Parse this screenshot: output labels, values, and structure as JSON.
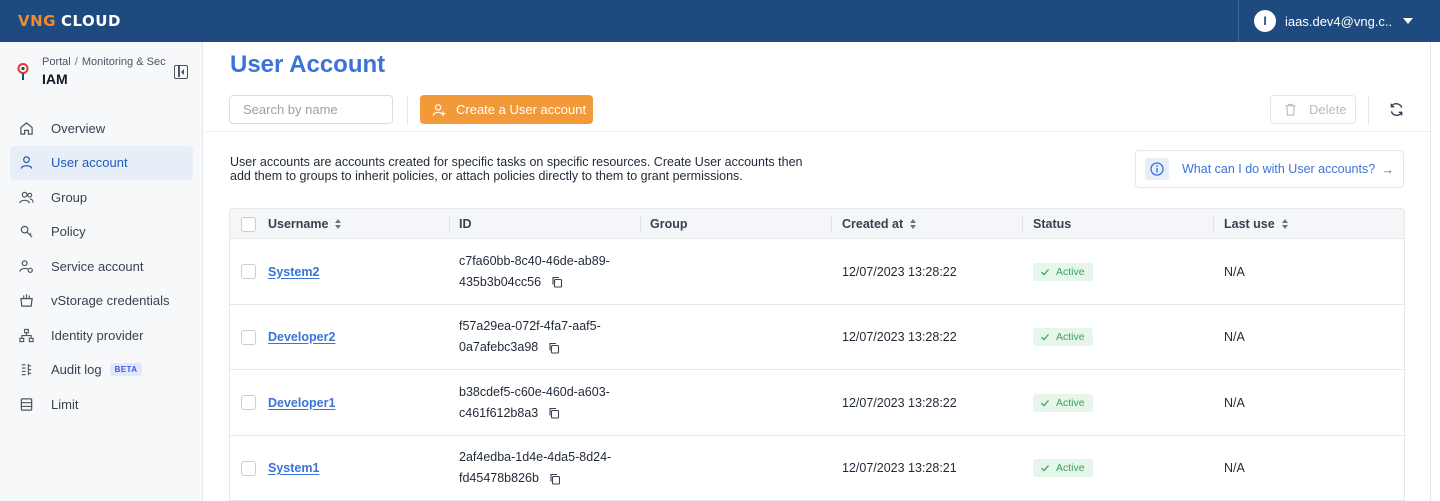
{
  "brand": {
    "logo_part1": "VNG",
    "logo_part2": "CLOUD",
    "color_dark": "#1e4a80",
    "color_accent": "#f08b2e"
  },
  "user": {
    "initial": "I",
    "email": "iaas.dev4@vng.c..."
  },
  "sidebar": {
    "breadcrumb": [
      "Portal",
      "Monitoring & Sec"
    ],
    "service_title": "IAM",
    "items": [
      {
        "label": "Overview",
        "icon": "home-icon"
      },
      {
        "label": "User account",
        "icon": "user-icon",
        "active": true
      },
      {
        "label": "Group",
        "icon": "group-icon"
      },
      {
        "label": "Policy",
        "icon": "policy-icon"
      },
      {
        "label": "Service account",
        "icon": "service-account-icon"
      },
      {
        "label": "vStorage credentials",
        "icon": "storage-credentials-icon"
      },
      {
        "label": "Identity provider",
        "icon": "identity-provider-icon"
      },
      {
        "label": "Audit log",
        "icon": "audit-log-icon",
        "badge": "BETA"
      },
      {
        "label": "Limit",
        "icon": "limit-icon"
      }
    ]
  },
  "main": {
    "title": "User Account",
    "search_placeholder": "Search by name",
    "create_label": "Create a User account",
    "delete_label": "Delete",
    "description": "User accounts are accounts created for specific tasks on specific resources. Create User accounts then add them to groups to inherit policies, or attach policies directly to them to grant permissions.",
    "help_link": "What can I do with User accounts?"
  },
  "table": {
    "columns": [
      "Username",
      "ID",
      "Group",
      "Created at",
      "Status",
      "Last use"
    ],
    "rows": [
      {
        "username": "System2",
        "id_line1": "c7fa60bb-8c40-46de-ab89-",
        "id_line2": "435b3b04cc56",
        "group": "",
        "created_at": "12/07/2023 13:28:22",
        "status": "Active",
        "last_use": "N/A"
      },
      {
        "username": "Developer2",
        "id_line1": "f57a29ea-072f-4fa7-aaf5-",
        "id_line2": "0a7afebc3a98",
        "group": "",
        "created_at": "12/07/2023 13:28:22",
        "status": "Active",
        "last_use": "N/A"
      },
      {
        "username": "Developer1",
        "id_line1": "b38cdef5-c60e-460d-a603-",
        "id_line2": "c461f612b8a3",
        "group": "",
        "created_at": "12/07/2023 13:28:22",
        "status": "Active",
        "last_use": "N/A"
      },
      {
        "username": "System1",
        "id_line1": "2af4edba-1d4e-4da5-8d24-",
        "id_line2": "fd45478b826b",
        "group": "",
        "created_at": "12/07/2023 13:28:21",
        "status": "Active",
        "last_use": "N/A"
      }
    ]
  },
  "colors": {
    "primary": "#3a74d9",
    "orange": "#f29a3a",
    "active_green": "#3aa35a"
  }
}
